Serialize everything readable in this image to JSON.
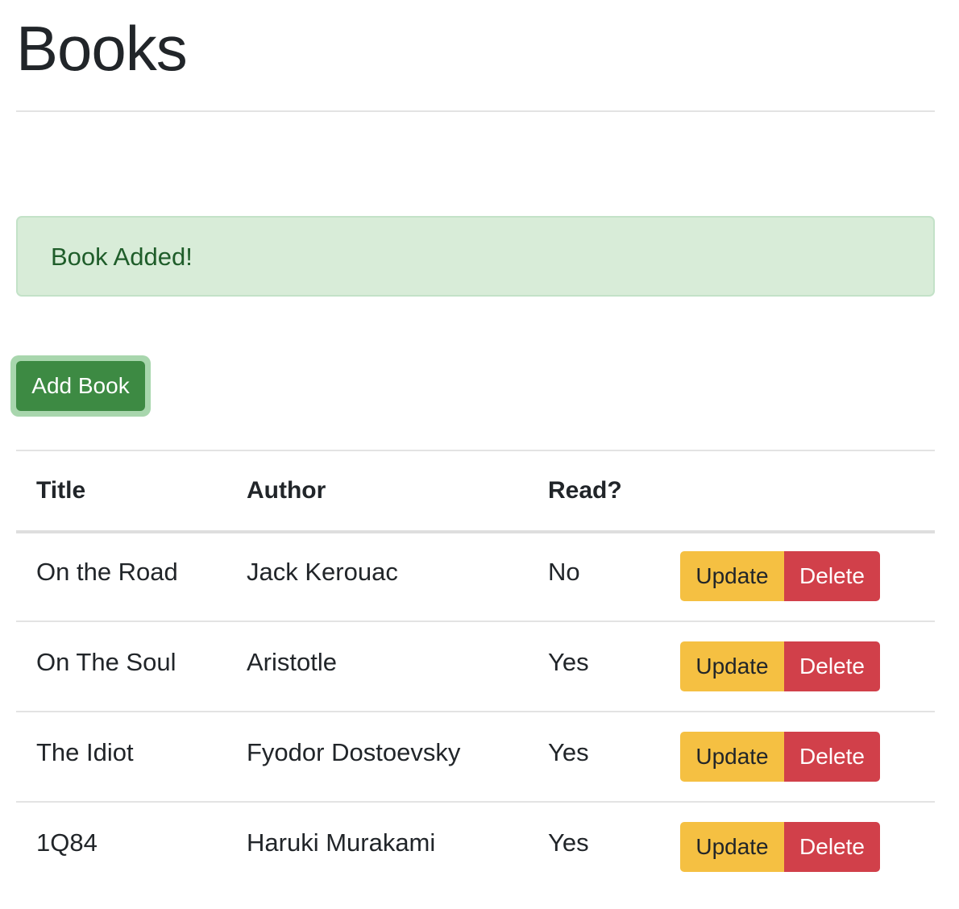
{
  "page": {
    "title": "Books"
  },
  "alert": {
    "message": "Book Added!"
  },
  "toolbar": {
    "add_label": "Add Book"
  },
  "table": {
    "headers": {
      "title": "Title",
      "author": "Author",
      "read": "Read?"
    },
    "rows": [
      {
        "title": "On the Road",
        "author": "Jack Kerouac",
        "read": "No",
        "update_label": "Update",
        "delete_label": "Delete"
      },
      {
        "title": "On The Soul",
        "author": "Aristotle",
        "read": "Yes",
        "update_label": "Update",
        "delete_label": "Delete"
      },
      {
        "title": "The Idiot",
        "author": "Fyodor Dostoevsky",
        "read": "Yes",
        "update_label": "Update",
        "delete_label": "Delete"
      },
      {
        "title": "1Q84",
        "author": "Haruki Murakami",
        "read": "Yes",
        "update_label": "Update",
        "delete_label": "Delete"
      }
    ]
  },
  "colors": {
    "success": "#3d8a43",
    "warning": "#f5c042",
    "danger": "#d1404a",
    "alert_bg": "#d8ecd8",
    "alert_text": "#1f5d2a"
  }
}
